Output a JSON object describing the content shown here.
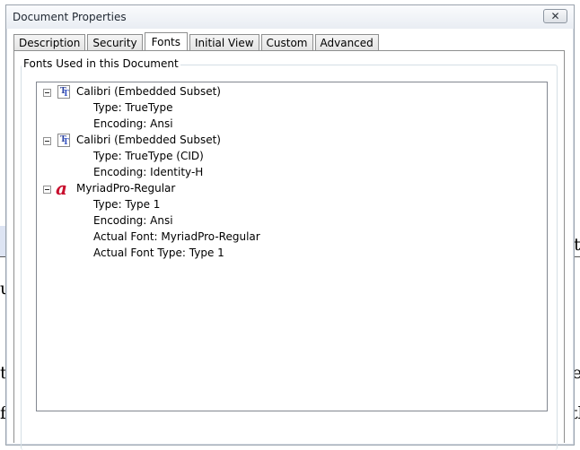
{
  "background": {
    "fragments": [
      "t",
      "u",
      "t",
      "e",
      "ft",
      "tl"
    ]
  },
  "dialog": {
    "title": "Document Properties",
    "close_glyph": "✕",
    "tabs": [
      {
        "label": "Description",
        "active": false
      },
      {
        "label": "Security",
        "active": false
      },
      {
        "label": "Fonts",
        "active": true
      },
      {
        "label": "Initial View",
        "active": false
      },
      {
        "label": "Custom",
        "active": false
      },
      {
        "label": "Advanced",
        "active": false
      }
    ],
    "group_label": "Fonts Used in this Document",
    "fonts": [
      {
        "name": "Calibri (Embedded Subset)",
        "icon": "truetype-font-icon",
        "details": [
          "Type: TrueType",
          "Encoding: Ansi"
        ]
      },
      {
        "name": "Calibri (Embedded Subset)",
        "icon": "truetype-font-icon",
        "details": [
          "Type: TrueType (CID)",
          "Encoding: Identity-H"
        ]
      },
      {
        "name": "MyriadPro-Regular",
        "icon": "type1-font-icon",
        "details": [
          "Type: Type 1",
          "Encoding: Ansi",
          "Actual Font: MyriadPro-Regular",
          "Actual Font Type: Type 1"
        ]
      }
    ]
  },
  "colors": {
    "type1_icon": "#c8102e",
    "truetype_icon": "#2a3f9a",
    "tree_border": "#828790"
  }
}
